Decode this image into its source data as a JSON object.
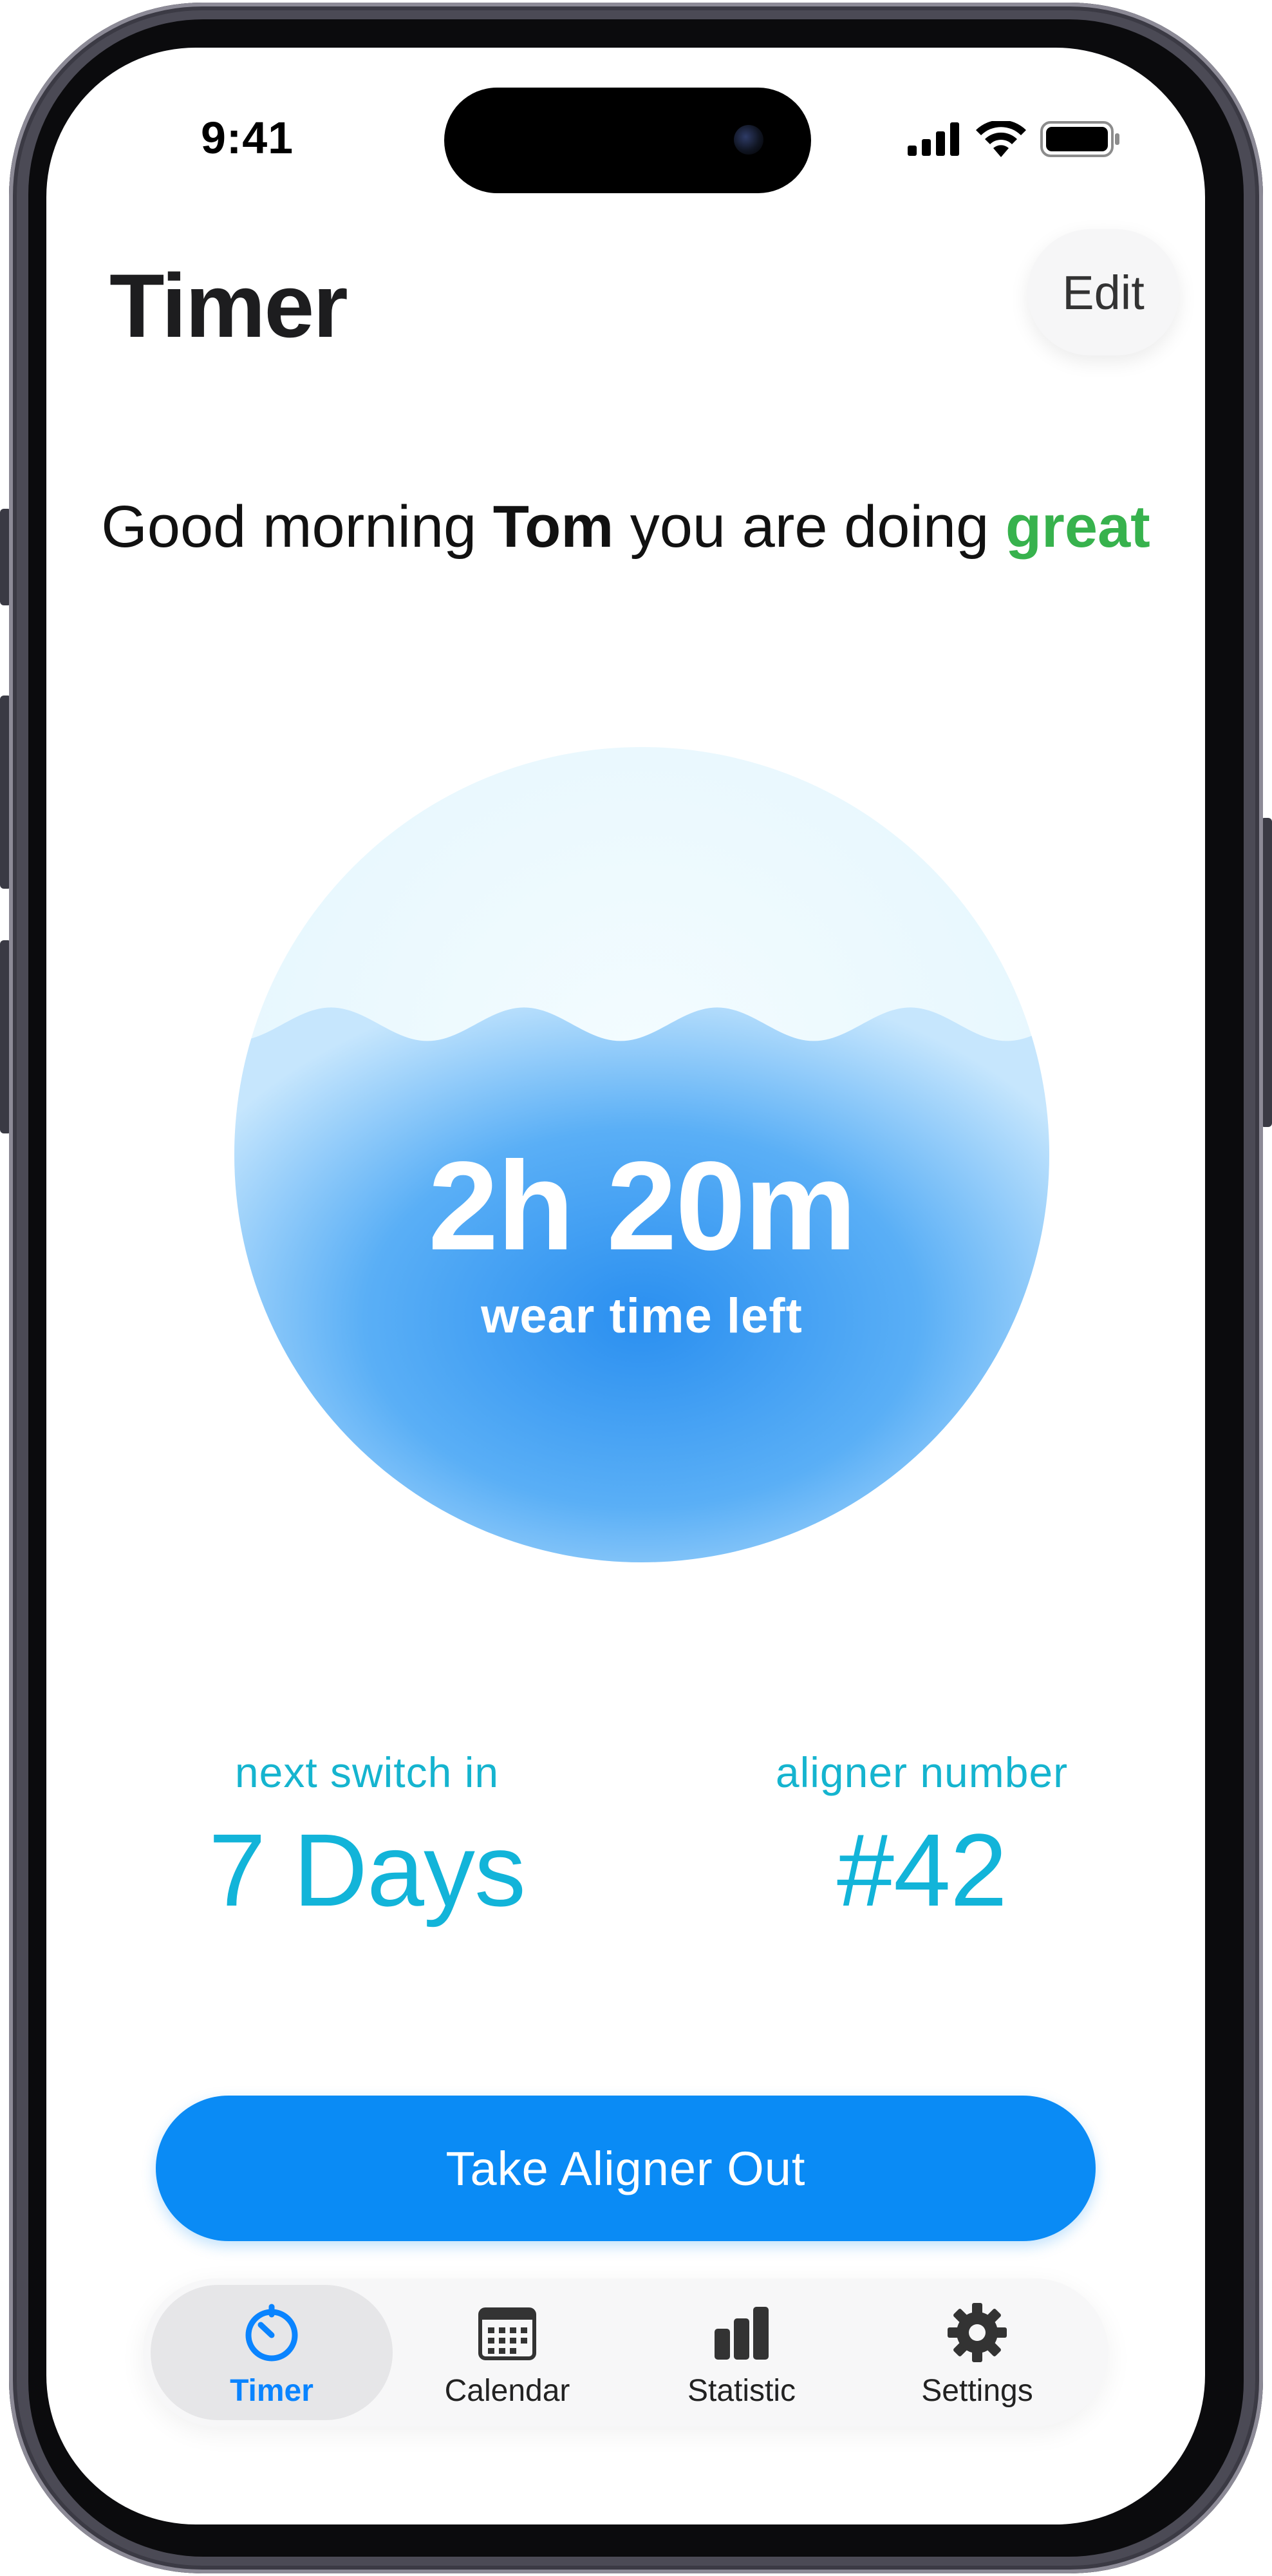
{
  "status_bar": {
    "time": "9:41",
    "icons": [
      "signal-icon",
      "wifi-icon",
      "battery-icon"
    ]
  },
  "header": {
    "title": "Timer",
    "edit_label": "Edit"
  },
  "greeting": {
    "prefix": "Good morning ",
    "name": "Tom",
    "middle": " you are doing ",
    "status_word": "great",
    "status_color": "#37b24d"
  },
  "wear_timer": {
    "value": "2h 20m",
    "caption": "wear time left",
    "fill_fraction": 0.66,
    "water_color": "#3d9df3"
  },
  "stats": {
    "next_switch": {
      "label": "next switch in",
      "value": "7 Days"
    },
    "aligner": {
      "label": "aligner number",
      "value": "#42"
    },
    "accent_color": "#12b4d9"
  },
  "primary_action": {
    "label": "Take Aligner Out",
    "color": "#0a8bf5"
  },
  "tab_bar": {
    "active_color": "#0a84ff",
    "tabs": [
      {
        "label": "Timer",
        "icon": "timer-icon",
        "active": true
      },
      {
        "label": "Calendar",
        "icon": "calendar-icon",
        "active": false
      },
      {
        "label": "Statistic",
        "icon": "bar-chart-icon",
        "active": false
      },
      {
        "label": "Settings",
        "icon": "gear-icon",
        "active": false
      }
    ]
  }
}
